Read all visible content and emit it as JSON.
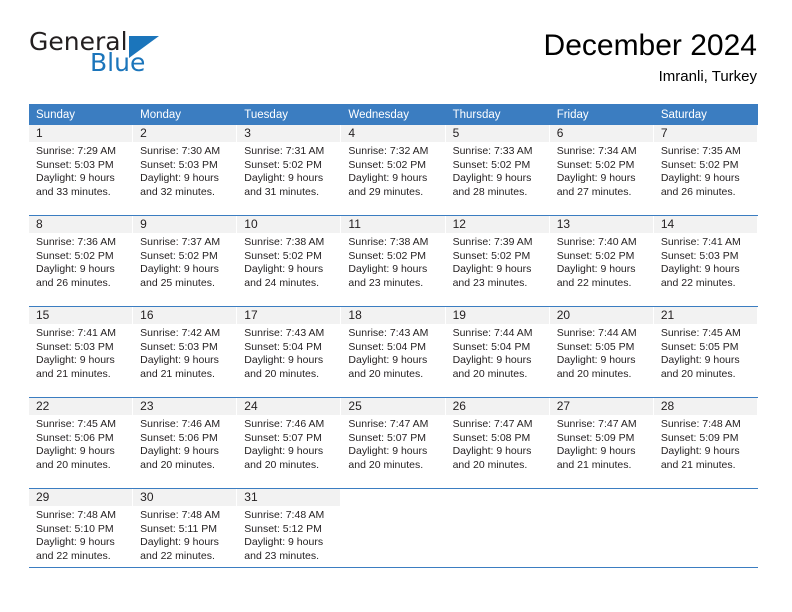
{
  "brand": {
    "name_top": "General",
    "name_bottom": "Blue",
    "accent_color": "#1b75bb"
  },
  "header": {
    "title": "December 2024",
    "subtitle": "Imranli, Turkey"
  },
  "calendar": {
    "header_bg": "#3b7dc1",
    "daynum_bg": "#f2f2f2",
    "weekday_headers": [
      "Sunday",
      "Monday",
      "Tuesday",
      "Wednesday",
      "Thursday",
      "Friday",
      "Saturday"
    ],
    "weeks": [
      [
        {
          "day": "1",
          "sunrise": "Sunrise: 7:29 AM",
          "sunset": "Sunset: 5:03 PM",
          "daylight1": "Daylight: 9 hours",
          "daylight2": "and 33 minutes."
        },
        {
          "day": "2",
          "sunrise": "Sunrise: 7:30 AM",
          "sunset": "Sunset: 5:03 PM",
          "daylight1": "Daylight: 9 hours",
          "daylight2": "and 32 minutes."
        },
        {
          "day": "3",
          "sunrise": "Sunrise: 7:31 AM",
          "sunset": "Sunset: 5:02 PM",
          "daylight1": "Daylight: 9 hours",
          "daylight2": "and 31 minutes."
        },
        {
          "day": "4",
          "sunrise": "Sunrise: 7:32 AM",
          "sunset": "Sunset: 5:02 PM",
          "daylight1": "Daylight: 9 hours",
          "daylight2": "and 29 minutes."
        },
        {
          "day": "5",
          "sunrise": "Sunrise: 7:33 AM",
          "sunset": "Sunset: 5:02 PM",
          "daylight1": "Daylight: 9 hours",
          "daylight2": "and 28 minutes."
        },
        {
          "day": "6",
          "sunrise": "Sunrise: 7:34 AM",
          "sunset": "Sunset: 5:02 PM",
          "daylight1": "Daylight: 9 hours",
          "daylight2": "and 27 minutes."
        },
        {
          "day": "7",
          "sunrise": "Sunrise: 7:35 AM",
          "sunset": "Sunset: 5:02 PM",
          "daylight1": "Daylight: 9 hours",
          "daylight2": "and 26 minutes."
        }
      ],
      [
        {
          "day": "8",
          "sunrise": "Sunrise: 7:36 AM",
          "sunset": "Sunset: 5:02 PM",
          "daylight1": "Daylight: 9 hours",
          "daylight2": "and 26 minutes."
        },
        {
          "day": "9",
          "sunrise": "Sunrise: 7:37 AM",
          "sunset": "Sunset: 5:02 PM",
          "daylight1": "Daylight: 9 hours",
          "daylight2": "and 25 minutes."
        },
        {
          "day": "10",
          "sunrise": "Sunrise: 7:38 AM",
          "sunset": "Sunset: 5:02 PM",
          "daylight1": "Daylight: 9 hours",
          "daylight2": "and 24 minutes."
        },
        {
          "day": "11",
          "sunrise": "Sunrise: 7:38 AM",
          "sunset": "Sunset: 5:02 PM",
          "daylight1": "Daylight: 9 hours",
          "daylight2": "and 23 minutes."
        },
        {
          "day": "12",
          "sunrise": "Sunrise: 7:39 AM",
          "sunset": "Sunset: 5:02 PM",
          "daylight1": "Daylight: 9 hours",
          "daylight2": "and 23 minutes."
        },
        {
          "day": "13",
          "sunrise": "Sunrise: 7:40 AM",
          "sunset": "Sunset: 5:02 PM",
          "daylight1": "Daylight: 9 hours",
          "daylight2": "and 22 minutes."
        },
        {
          "day": "14",
          "sunrise": "Sunrise: 7:41 AM",
          "sunset": "Sunset: 5:03 PM",
          "daylight1": "Daylight: 9 hours",
          "daylight2": "and 22 minutes."
        }
      ],
      [
        {
          "day": "15",
          "sunrise": "Sunrise: 7:41 AM",
          "sunset": "Sunset: 5:03 PM",
          "daylight1": "Daylight: 9 hours",
          "daylight2": "and 21 minutes."
        },
        {
          "day": "16",
          "sunrise": "Sunrise: 7:42 AM",
          "sunset": "Sunset: 5:03 PM",
          "daylight1": "Daylight: 9 hours",
          "daylight2": "and 21 minutes."
        },
        {
          "day": "17",
          "sunrise": "Sunrise: 7:43 AM",
          "sunset": "Sunset: 5:04 PM",
          "daylight1": "Daylight: 9 hours",
          "daylight2": "and 20 minutes."
        },
        {
          "day": "18",
          "sunrise": "Sunrise: 7:43 AM",
          "sunset": "Sunset: 5:04 PM",
          "daylight1": "Daylight: 9 hours",
          "daylight2": "and 20 minutes."
        },
        {
          "day": "19",
          "sunrise": "Sunrise: 7:44 AM",
          "sunset": "Sunset: 5:04 PM",
          "daylight1": "Daylight: 9 hours",
          "daylight2": "and 20 minutes."
        },
        {
          "day": "20",
          "sunrise": "Sunrise: 7:44 AM",
          "sunset": "Sunset: 5:05 PM",
          "daylight1": "Daylight: 9 hours",
          "daylight2": "and 20 minutes."
        },
        {
          "day": "21",
          "sunrise": "Sunrise: 7:45 AM",
          "sunset": "Sunset: 5:05 PM",
          "daylight1": "Daylight: 9 hours",
          "daylight2": "and 20 minutes."
        }
      ],
      [
        {
          "day": "22",
          "sunrise": "Sunrise: 7:45 AM",
          "sunset": "Sunset: 5:06 PM",
          "daylight1": "Daylight: 9 hours",
          "daylight2": "and 20 minutes."
        },
        {
          "day": "23",
          "sunrise": "Sunrise: 7:46 AM",
          "sunset": "Sunset: 5:06 PM",
          "daylight1": "Daylight: 9 hours",
          "daylight2": "and 20 minutes."
        },
        {
          "day": "24",
          "sunrise": "Sunrise: 7:46 AM",
          "sunset": "Sunset: 5:07 PM",
          "daylight1": "Daylight: 9 hours",
          "daylight2": "and 20 minutes."
        },
        {
          "day": "25",
          "sunrise": "Sunrise: 7:47 AM",
          "sunset": "Sunset: 5:07 PM",
          "daylight1": "Daylight: 9 hours",
          "daylight2": "and 20 minutes."
        },
        {
          "day": "26",
          "sunrise": "Sunrise: 7:47 AM",
          "sunset": "Sunset: 5:08 PM",
          "daylight1": "Daylight: 9 hours",
          "daylight2": "and 20 minutes."
        },
        {
          "day": "27",
          "sunrise": "Sunrise: 7:47 AM",
          "sunset": "Sunset: 5:09 PM",
          "daylight1": "Daylight: 9 hours",
          "daylight2": "and 21 minutes."
        },
        {
          "day": "28",
          "sunrise": "Sunrise: 7:48 AM",
          "sunset": "Sunset: 5:09 PM",
          "daylight1": "Daylight: 9 hours",
          "daylight2": "and 21 minutes."
        }
      ],
      [
        {
          "day": "29",
          "sunrise": "Sunrise: 7:48 AM",
          "sunset": "Sunset: 5:10 PM",
          "daylight1": "Daylight: 9 hours",
          "daylight2": "and 22 minutes."
        },
        {
          "day": "30",
          "sunrise": "Sunrise: 7:48 AM",
          "sunset": "Sunset: 5:11 PM",
          "daylight1": "Daylight: 9 hours",
          "daylight2": "and 22 minutes."
        },
        {
          "day": "31",
          "sunrise": "Sunrise: 7:48 AM",
          "sunset": "Sunset: 5:12 PM",
          "daylight1": "Daylight: 9 hours",
          "daylight2": "and 23 minutes."
        },
        {
          "day": "",
          "sunrise": "",
          "sunset": "",
          "daylight1": "",
          "daylight2": ""
        },
        {
          "day": "",
          "sunrise": "",
          "sunset": "",
          "daylight1": "",
          "daylight2": ""
        },
        {
          "day": "",
          "sunrise": "",
          "sunset": "",
          "daylight1": "",
          "daylight2": ""
        },
        {
          "day": "",
          "sunrise": "",
          "sunset": "",
          "daylight1": "",
          "daylight2": ""
        }
      ]
    ]
  }
}
